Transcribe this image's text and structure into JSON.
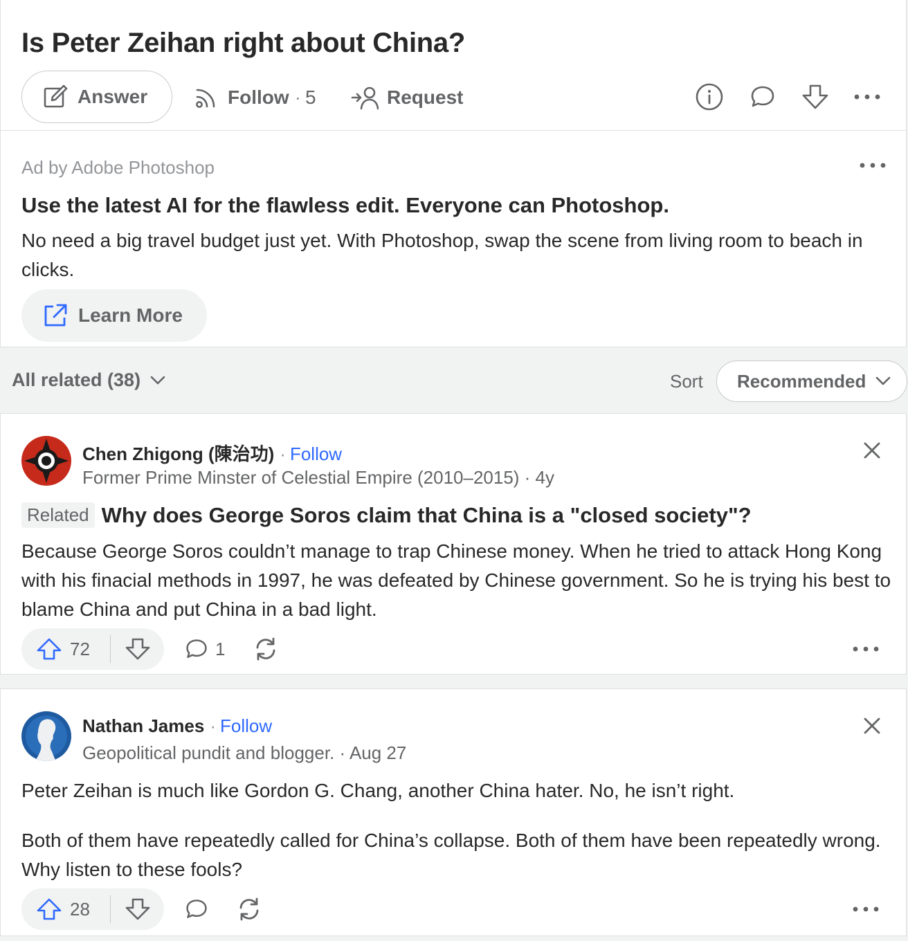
{
  "question": {
    "title": "Is Peter Zeihan right about China?",
    "answer_label": "Answer",
    "follow_label": "Follow",
    "follow_count": "5",
    "request_label": "Request"
  },
  "ad": {
    "by": "Ad by Adobe Photoshop",
    "headline": "Use the latest AI for the flawless edit. Everyone can Photoshop.",
    "body": "No need a big travel budget just yet. With Photoshop, swap the scene from living room to beach in clicks.",
    "cta": "Learn More"
  },
  "related_bar": {
    "filter_label": "All related (38)",
    "sort_label": "Sort",
    "sort_value": "Recommended"
  },
  "answers": [
    {
      "author": "Chen Zhigong (陳治功)",
      "follow": "Follow",
      "credential": "Former Prime Minster of Celestial Empire (2010–2015) · 4y",
      "related_tag": "Related",
      "related_question": "Why does George Soros claim that China is a \"closed society\"?",
      "text": "Because George Soros couldn’t manage to trap Chinese money. When he tried to attack Hong Kong with his finacial methods in 1997, he was defeated by Chinese government. So he is trying his best to blame China and put China in a bad light.",
      "upvotes": "72",
      "comments": "1"
    },
    {
      "author": "Nathan James",
      "follow": "Follow",
      "credential": "Geopolitical pundit and blogger. · Aug 27",
      "paragraph1": "Peter Zeihan is much like Gordon G. Chang, another China hater. No, he isn’t right.",
      "paragraph2": "Both of them have repeatedly called for China’s collapse. Both of them have been repeatedly wrong. Why listen to these fools?",
      "upvotes": "28"
    }
  ],
  "colors": {
    "accent_blue": "#2e69ff",
    "text_primary": "#282829",
    "text_secondary": "#636466",
    "page_bg": "#f1f2f2"
  }
}
